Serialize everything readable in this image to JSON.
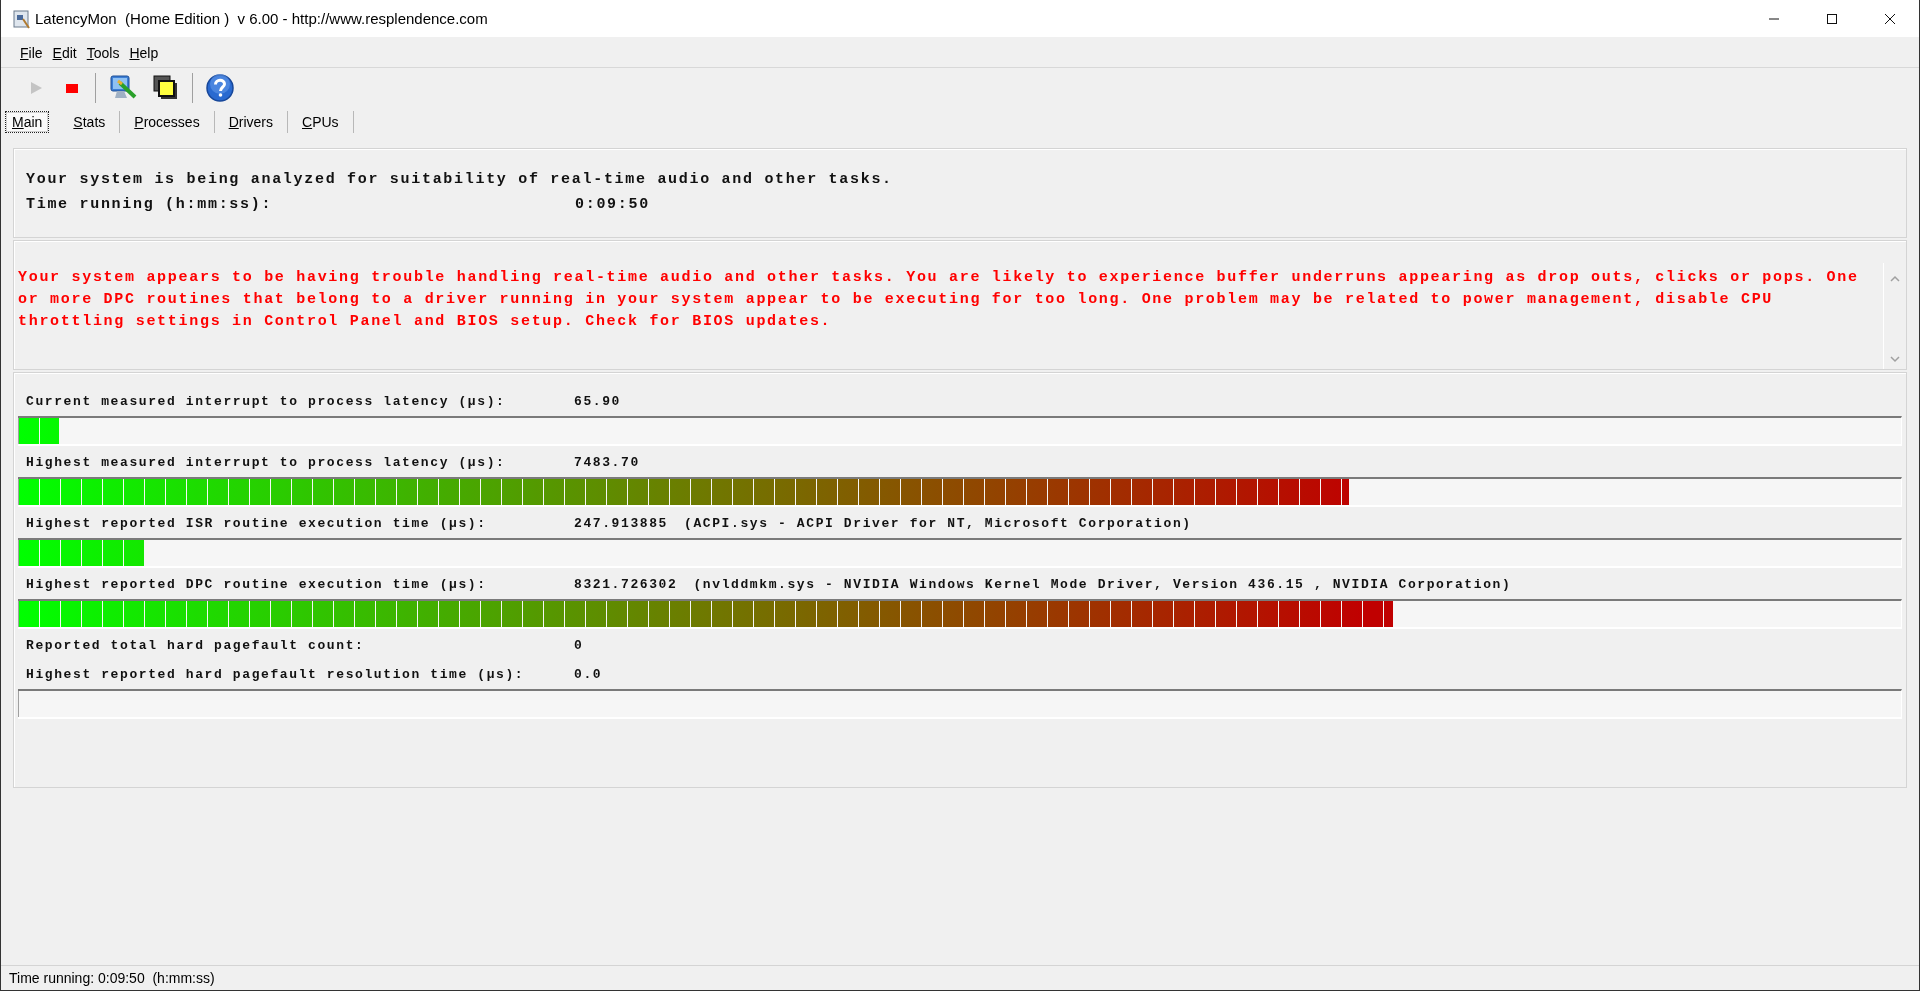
{
  "window": {
    "title": "LatencyMon  (Home Edition )  v 6.00 - http://www.resplendence.com"
  },
  "menu": [
    "File",
    "Edit",
    "Tools",
    "Help"
  ],
  "toolbar": [
    {
      "buttons": [
        {
          "kind": "play",
          "disabled": true
        },
        {
          "kind": "stop",
          "disabled": false
        }
      ]
    },
    {
      "buttons": [
        {
          "kind": "monitor",
          "disabled": false
        },
        {
          "kind": "windows",
          "disabled": false
        }
      ]
    },
    {
      "buttons": [
        {
          "kind": "help",
          "disabled": false
        }
      ]
    }
  ],
  "tabs": [
    {
      "label": "Main",
      "selected": true
    },
    {
      "label": "Stats",
      "selected": false
    },
    {
      "label": "Processes",
      "selected": false
    },
    {
      "label": "Drivers",
      "selected": false
    },
    {
      "label": "CPUs",
      "selected": false
    }
  ],
  "summary": {
    "message": "Your system is being analyzed for suitability of real-time audio and other tasks.",
    "time_label": "Time running (h:mm:ss):",
    "time_value": "0:09:50"
  },
  "warning": {
    "text": "Your system appears to be having trouble handling real-time audio and other tasks. You are likely to experience buffer underruns appearing as drop outs, clicks or pops. One or more DPC routines that belong to a driver running in your system appear to be executing for too long. One problem may be related to power management, disable CPU throttling settings in Control Panel and BIOS setup. Check for BIOS updates."
  },
  "metrics": [
    {
      "kind": "meter",
      "label": "Current measured interrupt to process latency (µs):",
      "value": "65.90",
      "level": 0.022
    },
    {
      "kind": "meter",
      "label": "Highest measured interrupt to process latency (µs):",
      "value": "7483.70",
      "level": 0.707
    },
    {
      "kind": "meter",
      "label": "Highest reported ISR routine execution time (µs):",
      "value": "247.913885",
      "detail": "(ACPI.sys - ACPI Driver for NT, Microsoft Corporation)",
      "level": 0.067
    },
    {
      "kind": "meter",
      "label": "Highest reported DPC routine execution time (µs):",
      "value": "8321.726302",
      "detail": "(nvlddmkm.sys - NVIDIA Windows Kernel Mode Driver, Version 436.15 , NVIDIA Corporation)",
      "level": 0.73
    },
    {
      "kind": "plain",
      "label": "Reported total hard pagefault count:",
      "value": "0"
    },
    {
      "kind": "meter",
      "label": "Highest reported hard pagefault resolution time (µs):",
      "value": "0.0",
      "level": 0
    }
  ],
  "status_bar": {
    "text": "Time running: 0:09:50  (h:mm:ss)"
  }
}
